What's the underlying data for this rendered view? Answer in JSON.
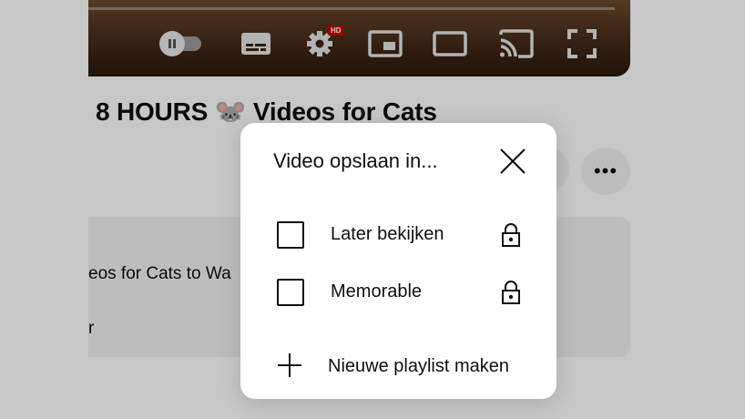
{
  "video": {
    "title": "8 HOURS 🐭 Videos for Cats",
    "description_line1": "eos for Cats to Wa",
    "description_line2": "r",
    "hd_badge": "HD"
  },
  "player_controls": {
    "icons": [
      "autoplay-toggle",
      "subtitles-icon",
      "settings-icon",
      "miniplayer-icon",
      "theater-mode-icon",
      "cast-icon",
      "fullscreen-icon"
    ]
  },
  "actions": {
    "more_label": "•••"
  },
  "dialog": {
    "title": "Video opslaan in...",
    "playlists": [
      {
        "label": "Later bekijken",
        "checked": false,
        "private": true
      },
      {
        "label": "Memorable",
        "checked": false,
        "private": true
      }
    ],
    "new_playlist_label": "Nieuwe playlist maken"
  },
  "colors": {
    "text": "#0f0f0f",
    "dialog_bg": "#ffffff",
    "scrim": "rgba(0,0,0,0.22)",
    "hd_red": "#cc0000"
  }
}
